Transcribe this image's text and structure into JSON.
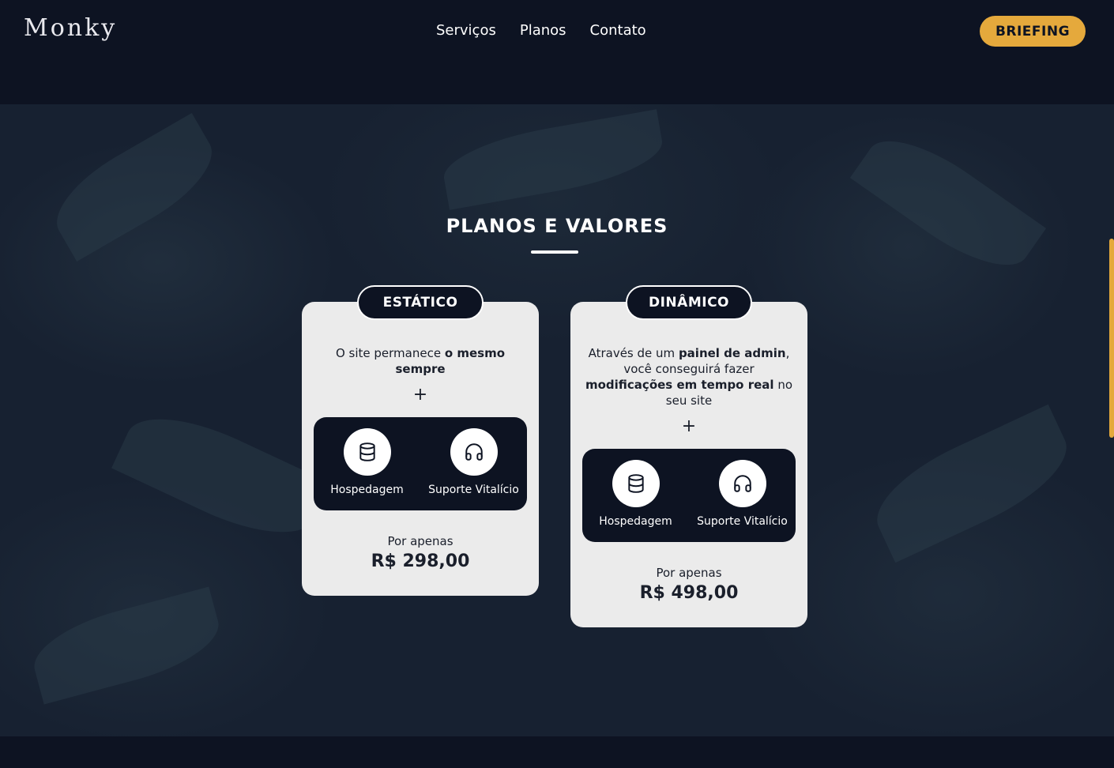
{
  "header": {
    "logo": "Monky",
    "nav": [
      "Serviços",
      "Planos",
      "Contato"
    ],
    "cta_label": "BRIEFING"
  },
  "section": {
    "title": "PLANOS E VALORES"
  },
  "plans": [
    {
      "name": "ESTÁTICO",
      "desc_parts": [
        "O site permanece ",
        "o mesmo sempre",
        ""
      ],
      "plus": "+",
      "features": [
        {
          "icon": "database-icon",
          "label": "Hospedagem"
        },
        {
          "icon": "headphones-icon",
          "label": "Suporte Vitalício"
        }
      ],
      "price_label": "Por apenas",
      "price": "R$ 298,00"
    },
    {
      "name": "DINÂMICO",
      "desc_parts": [
        "Através de um ",
        "painel de admin",
        ", você conseguirá fazer ",
        "modificações em tempo real",
        " no seu site"
      ],
      "plus": "+",
      "features": [
        {
          "icon": "database-icon",
          "label": "Hospedagem"
        },
        {
          "icon": "headphones-icon",
          "label": "Suporte Vitalício"
        }
      ],
      "price_label": "Por apenas",
      "price": "R$ 498,00"
    }
  ],
  "colors": {
    "background": "#0d1322",
    "accent": "#e5a93c",
    "card": "#ebebeb"
  }
}
